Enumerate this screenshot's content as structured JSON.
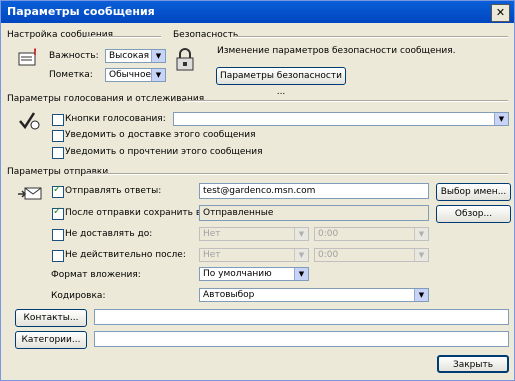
{
  "window": {
    "title": "Параметры сообщения",
    "close_glyph": "✕"
  },
  "message_settings": {
    "section": "Настройка сообщения",
    "importance_label": "Важность:",
    "importance_value": "Высокая",
    "sensitivity_label": "Пометка:",
    "sensitivity_value": "Обычное"
  },
  "security": {
    "section": "Безопасность",
    "description": "Изменение параметров безопасности сообщения.",
    "button": "Параметры безопасности ..."
  },
  "voting": {
    "section": "Параметры голосования и отслеживания",
    "voting_buttons_label": "Кнопки голосования:",
    "voting_buttons_value": "",
    "delivery_receipt_label": "Уведомить о доставке этого сообщения",
    "read_receipt_label": "Уведомить о прочтении этого сообщения"
  },
  "delivery": {
    "section": "Параметры отправки",
    "reply_to_label": "Отправлять ответы:",
    "reply_to_value": "test@gardenco.msn.com",
    "select_names_button": "Выбор имен...",
    "save_sent_label": "После отправки сохранить в:",
    "save_sent_value": "Отправленные",
    "browse_button": "Обзор...",
    "do_not_deliver_label": "Не доставлять до:",
    "do_not_deliver_date": "Нет",
    "do_not_deliver_time": "0:00",
    "expires_label": "Не действительно после:",
    "expires_date": "Нет",
    "expires_time": "0:00",
    "attachment_format_label": "Формат вложения:",
    "attachment_format_value": "По умолчанию",
    "encoding_label": "Кодировка:",
    "encoding_value": "Автовыбор"
  },
  "contacts_button": "Контакты...",
  "contacts_value": "",
  "categories_button": "Категории...",
  "categories_value": "",
  "close_button": "Закрыть",
  "dropdown_arrow": "▼"
}
